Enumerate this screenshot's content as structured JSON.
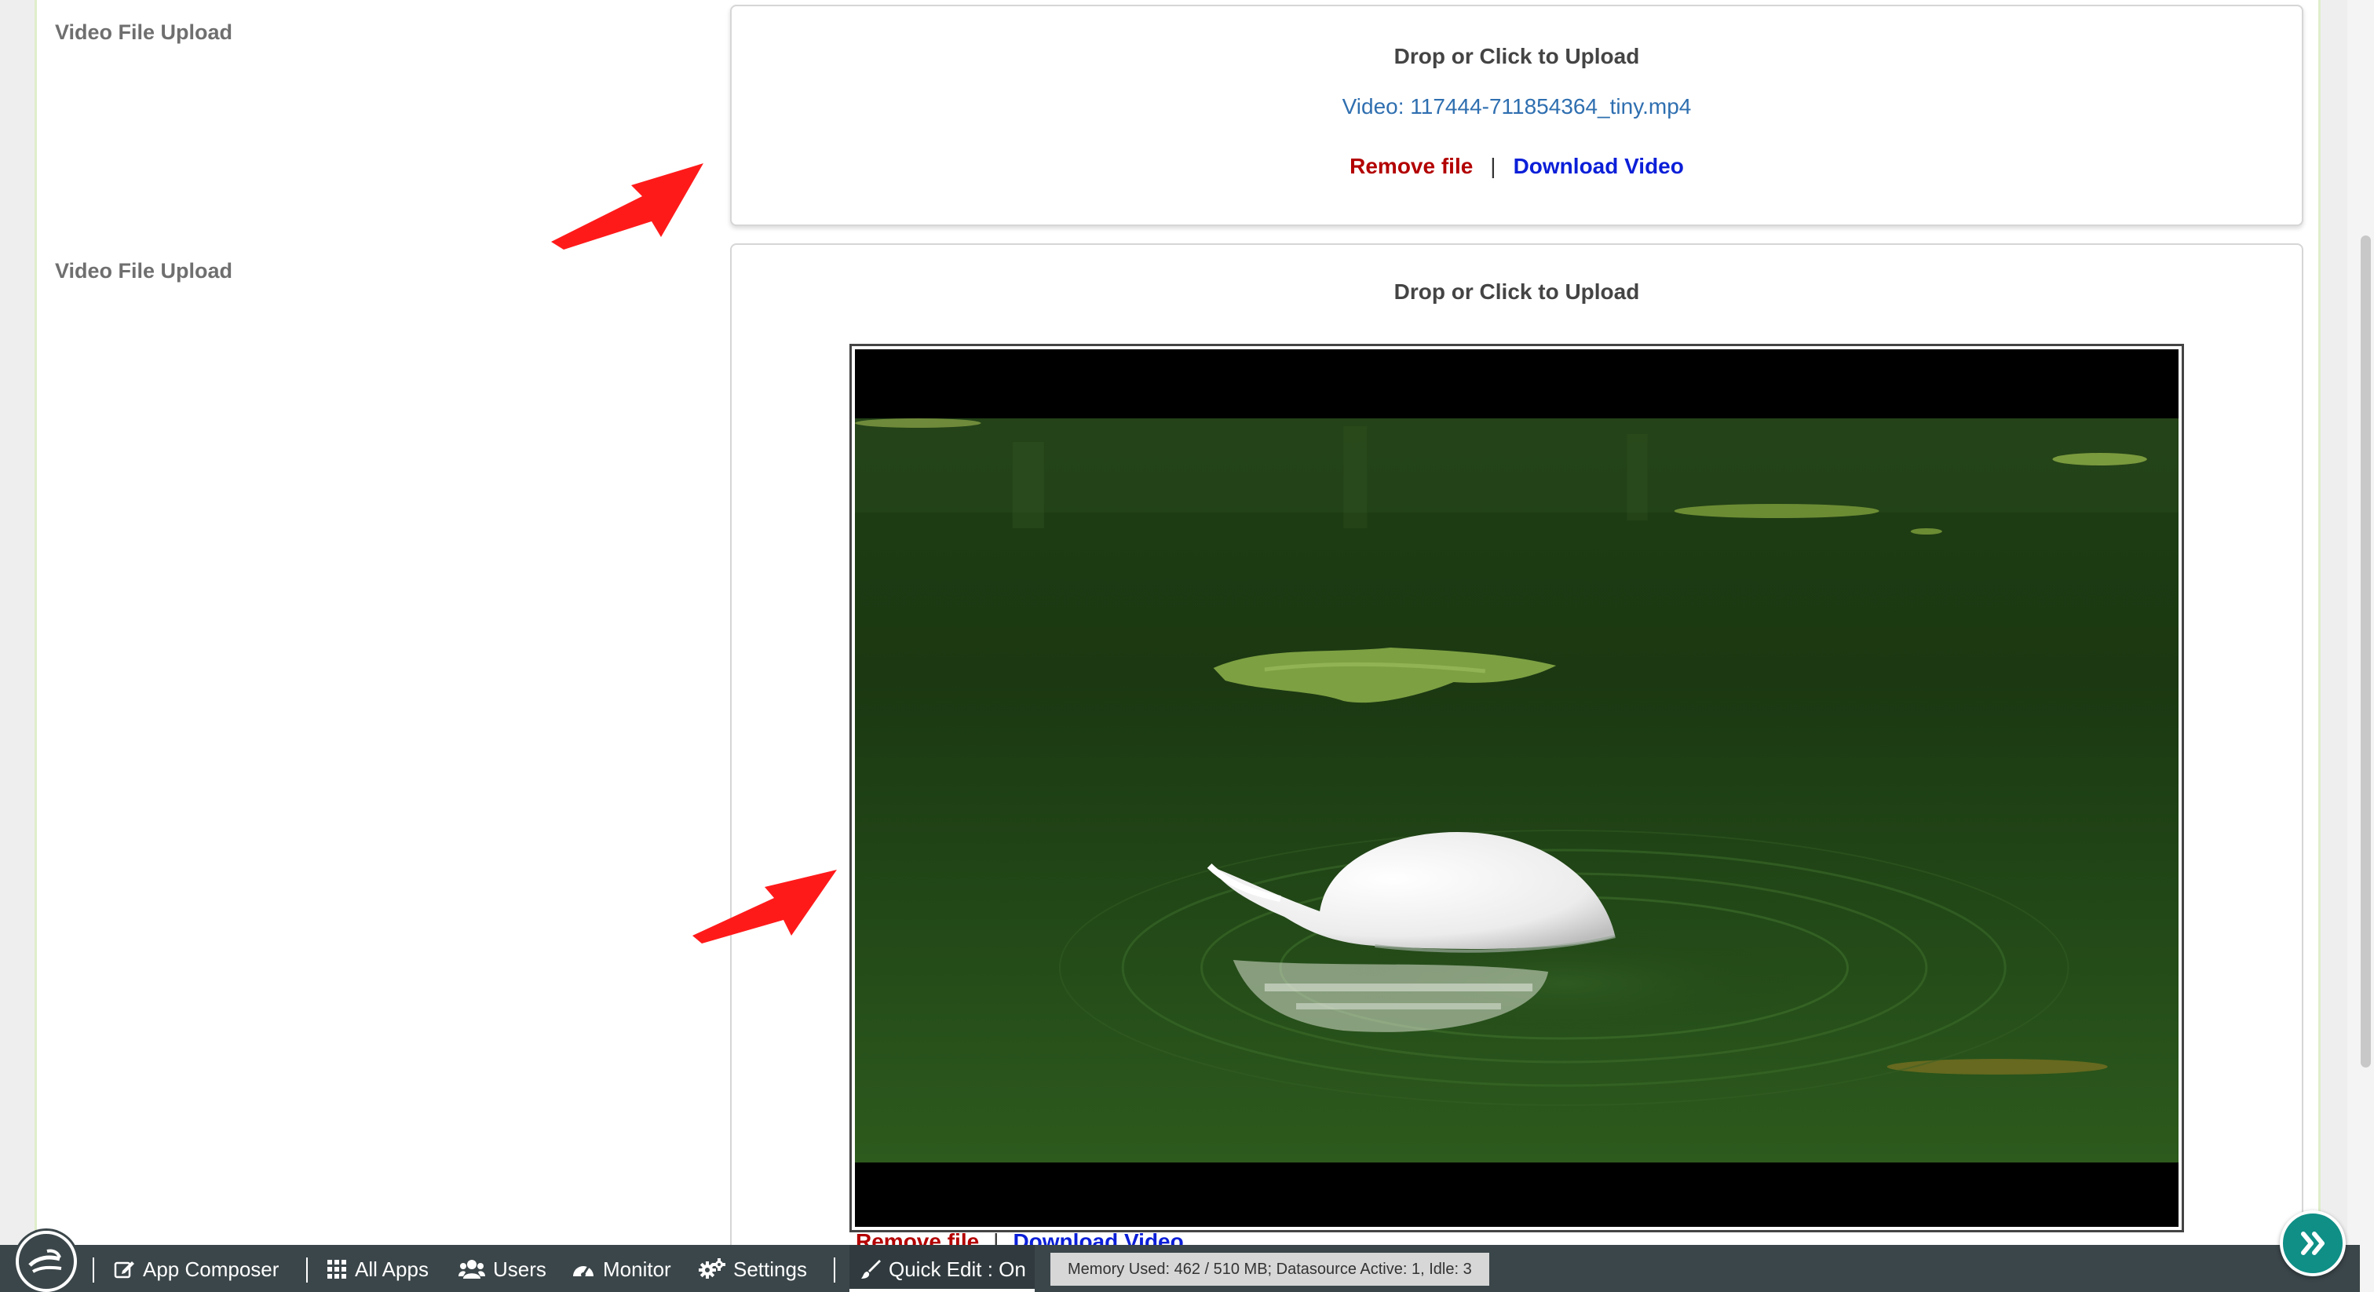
{
  "fields": [
    {
      "label": "Video File Upload",
      "upload_title": "Drop or Click to Upload",
      "file_name": "Video: 117444-711854364_tiny.mp4",
      "remove_label": "Remove file",
      "separator": "|",
      "download_label": "Download Video"
    },
    {
      "label": "Video File Upload",
      "upload_title": "Drop or Click to Upload",
      "remove_label": "Remove file",
      "separator": "|",
      "download_label": "Download Video",
      "video_preview": "swan-on-pond"
    }
  ],
  "bottom_bar": {
    "logo_icon": "app-logo-icon",
    "items": [
      {
        "label": "App Composer",
        "icon": "edit-icon"
      },
      {
        "label": "All Apps",
        "icon": "grid-icon"
      },
      {
        "label": "Users",
        "icon": "users-icon"
      },
      {
        "label": "Monitor",
        "icon": "dashboard-icon"
      },
      {
        "label": "Settings",
        "icon": "gears-icon"
      },
      {
        "label": "Quick Edit : On",
        "icon": "brush-icon"
      }
    ],
    "memory_status": "Memory Used: 462 / 510 MB; Datasource Active: 1, Idle: 3"
  },
  "fab_icon": "double-chevron-right-icon",
  "annotations": {
    "arrow_color": "#ff1a1a"
  },
  "colors": {
    "remove_link": "#b30000",
    "download_link": "#0b1fd8",
    "file_link": "#2f6fb0",
    "bottom_bar": "#3b464a",
    "fab": "#0f8f86"
  }
}
